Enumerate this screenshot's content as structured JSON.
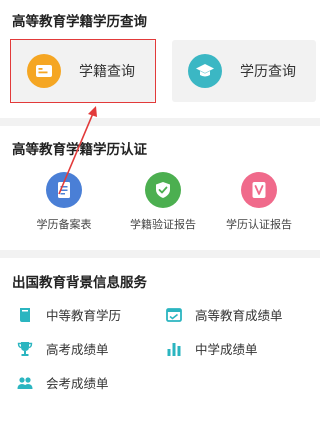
{
  "query": {
    "title": "高等教育学籍学历查询",
    "xueji_label": "学籍查询",
    "xueli_label": "学历查询",
    "xueji_color": "#f5a623",
    "xueli_color": "#3bb7c4"
  },
  "cert": {
    "title": "高等教育学籍学历认证",
    "items": [
      {
        "label": "学历备案表",
        "color": "#4a7fd6"
      },
      {
        "label": "学籍验证报告",
        "color": "#4caf50"
      },
      {
        "label": "学历认证报告",
        "color": "#f06a8b"
      }
    ]
  },
  "services": {
    "title": "出国教育背景信息服务",
    "items": [
      {
        "label": "中等教育学历",
        "icon": "book-icon"
      },
      {
        "label": "高等教育成绩单",
        "icon": "report-card-icon"
      },
      {
        "label": "高考成绩单",
        "icon": "trophy-icon"
      },
      {
        "label": "中学成绩单",
        "icon": "bar-chart-icon"
      },
      {
        "label": "会考成绩单",
        "icon": "people-icon"
      }
    ],
    "icon_color": "#2bb5c0"
  },
  "annotation": {
    "color": "#e23a3a"
  }
}
